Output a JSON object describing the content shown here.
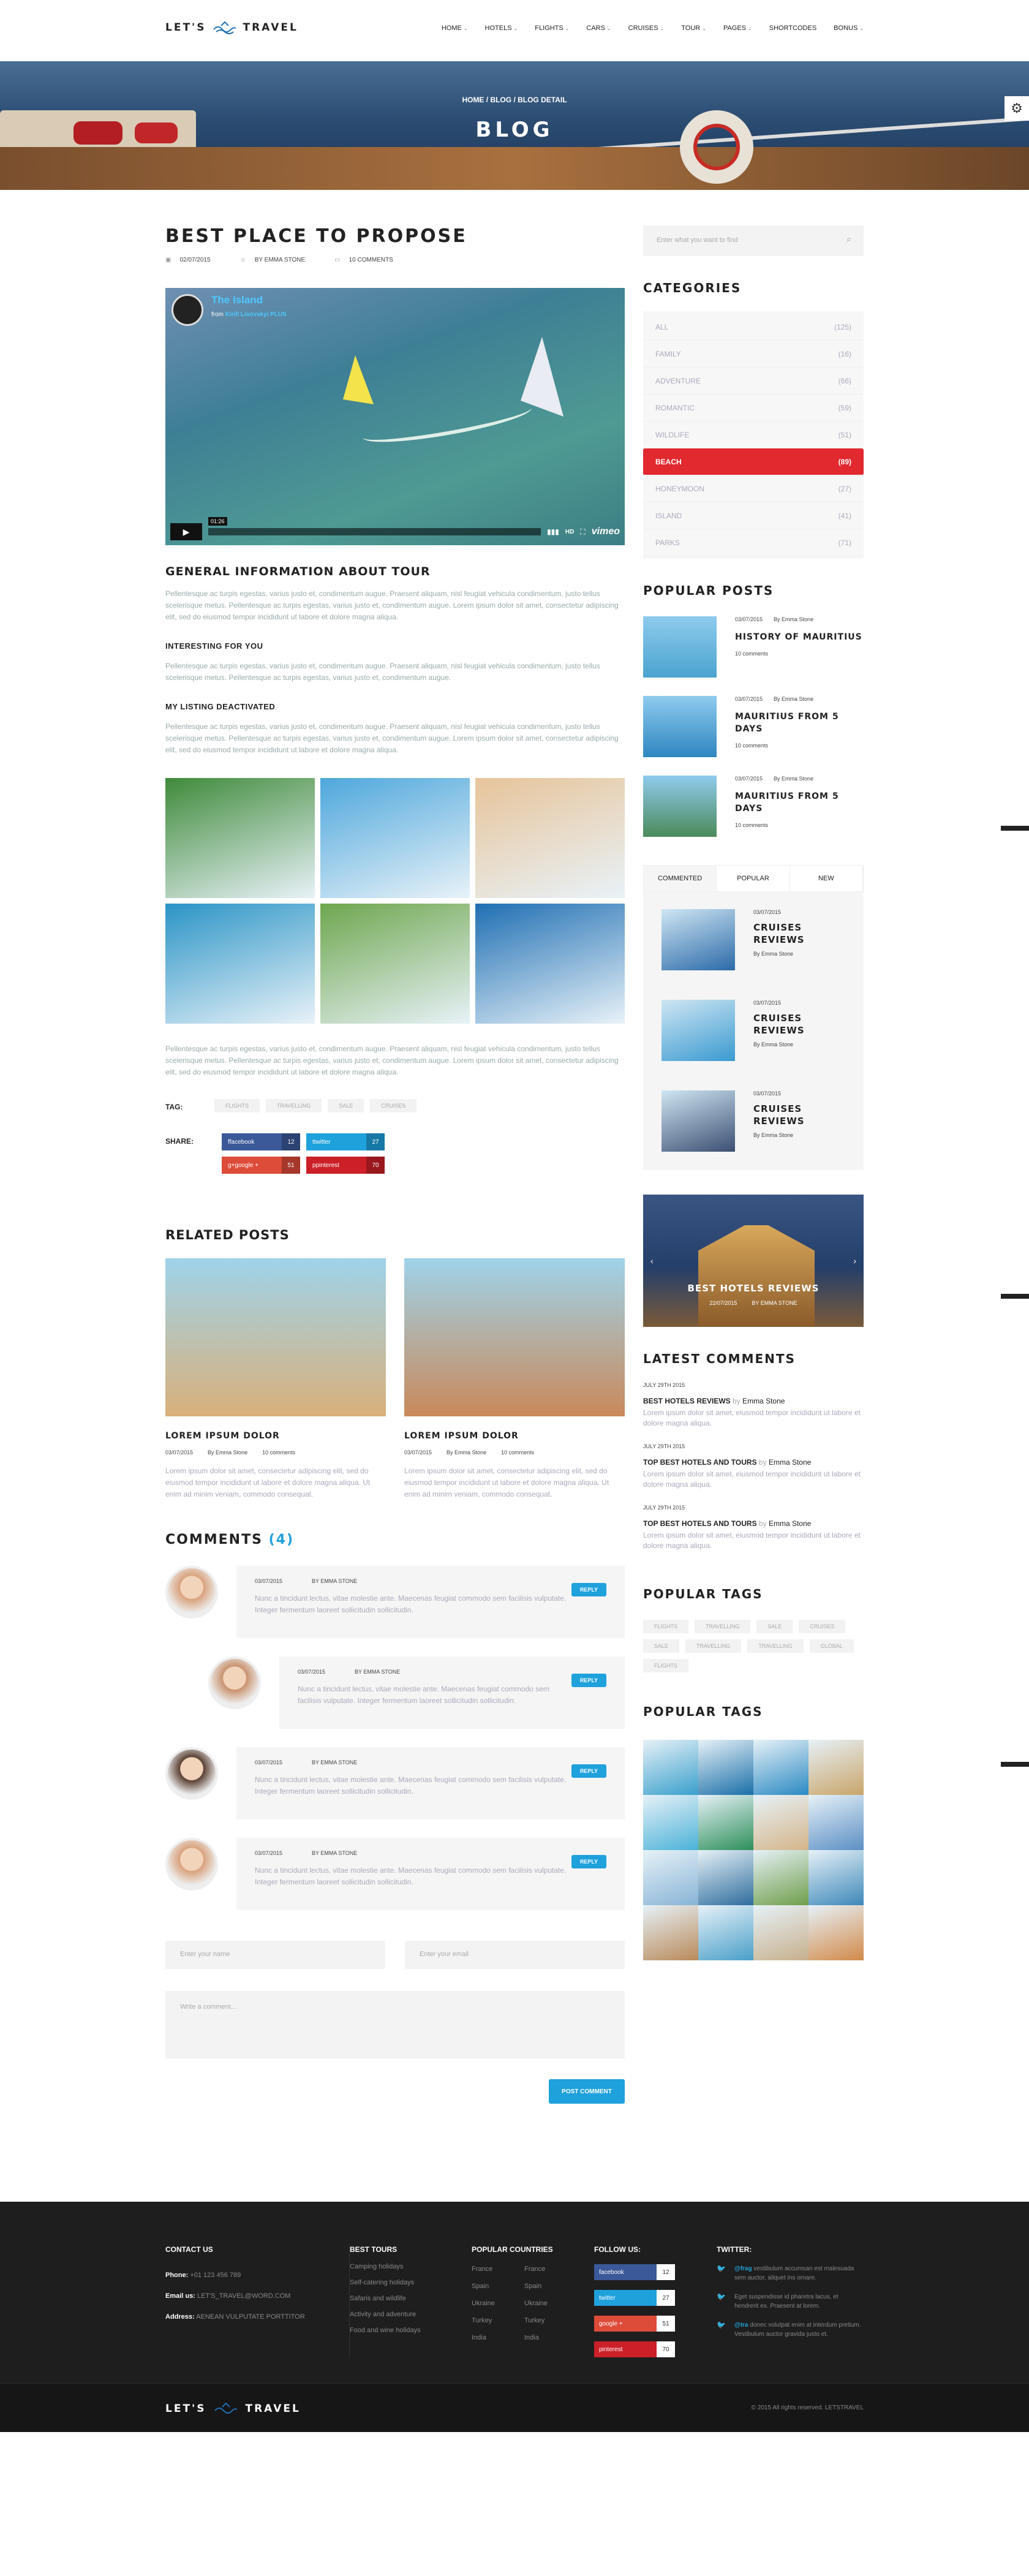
{
  "brand": {
    "name_left": "LET'S",
    "name_right": "TRAVEL"
  },
  "menu": [
    {
      "label": "HOME",
      "caret": "⌄"
    },
    {
      "label": "HOTELS",
      "caret": "⌄"
    },
    {
      "label": "FLIGHTS",
      "caret": "⌄"
    },
    {
      "label": "CARS",
      "caret": "⌄"
    },
    {
      "label": "CRUISES",
      "caret": "⌄"
    },
    {
      "label": "TOUR",
      "caret": "⌄"
    },
    {
      "label": "PAGES",
      "caret": "⌄"
    },
    {
      "label": "SHORTCODES",
      "caret": ""
    },
    {
      "label": "BONUS",
      "caret": "⌄"
    }
  ],
  "hero": {
    "breadcrumb": "HOME / BLOG / BLOG DETAIL",
    "title": "BLOG"
  },
  "post": {
    "title": "BEST PLACE TO PROPOSE",
    "date": "02/07/2015",
    "author": "BY EMMA STONE",
    "comments": "10 COMMENTS"
  },
  "video": {
    "title": "The Island",
    "from": "from",
    "owner": "Kirill Lisovskyi",
    "badge": "PLUS",
    "time": "01:26",
    "brand": "vimeo"
  },
  "section": {
    "heading": "GENERAL INFORMATION ABOUT TOUR",
    "para1": "Pellentesque ac turpis egestas, varius justo et, condimentum augue. Praesent aliquam, nisl feugiat vehicula condimentum, justo tellus scelerisque metus. Pellentesque ac turpis egestas, varius justo et, condimentum augue. Lorem ipsum dolor sit amet, consectetur adipiscing elit, sed do eiusmod tempor incididunt ut labore et dolore magna aliqua.",
    "sub1": "INTERESTING FOR YOU",
    "para2": "Pellentesque ac turpis egestas, varius justo et, condimentum augue. Praesent aliquam, nisl feugiat vehicula condimentum, justo tellus scelerisque metus. Pellentesque ac turpis egestas, varius justo et, condimentum augue.",
    "sub2": "MY LISTING DEACTIVATED",
    "para3": "Pellentesque ac turpis egestas, varius justo et, condimentum augue. Praesent aliquam, nisl feugiat vehicula condimentum, justo tellus scelerisque metus. Pellentesque ac turpis egestas, varius justo et, condimentum augue. Lorem ipsum dolor sit amet, consectetur adipiscing elit, sed do eiusmod tempor incididunt ut labore et dolore magna aliqua.",
    "para4": "Pellentesque ac turpis egestas, varius justo et, condimentum augue. Praesent aliquam, nisl feugiat vehicula condimentum, justo tellus scelerisque metus. Pellentesque ac turpis egestas, varius justo et, condimentum augue. Lorem ipsum dolor sit amet, consectetur adipiscing elit, sed do eiusmod tempor incididunt ut labore et dolore magna aliqua."
  },
  "gallery_colors": [
    "#3f8a3a",
    "#4ea7dc",
    "#e7c49a",
    "#2b94c6",
    "#6ea64e",
    "#1f6fb3"
  ],
  "tags": {
    "label": "TAG:",
    "items": [
      "FLIGHTS",
      "TRAVELLING",
      "SALE",
      "CRUISES"
    ]
  },
  "share": {
    "label": "SHARE:",
    "items": [
      {
        "name": "facebook",
        "count": "12",
        "color": "#3b5998"
      },
      {
        "name": "twitter",
        "count": "27",
        "color": "#1fa1dc"
      },
      {
        "name": "google +",
        "count": "51",
        "color": "#dd4b39"
      },
      {
        "name": "pinterest",
        "count": "70",
        "color": "#cb2027"
      }
    ]
  },
  "related": {
    "heading": "RELATED POSTS",
    "posts": [
      {
        "title": "LOREM IPSUM DOLOR",
        "date": "03/07/2015",
        "author": "By Emma Stone",
        "comments": "10 comments",
        "text": "Lorem ipsum dolor sit amet, consectetur adipiscing elit, sed do eiusmod tempor incididunt ut labore et dolore magna aliqua. Ut enim ad minim veniam, commodo consequat.",
        "color": "#d9b07a"
      },
      {
        "title": "LOREM IPSUM DOLOR",
        "date": "03/07/2015",
        "author": "By Emma Stone",
        "comments": "10 comments",
        "text": "Lorem ipsum dolor sit amet, consectetur adipiscing elit, sed do eiusmod tempor incididunt ut labore et dolore magna aliqua. Ut enim ad minim veniam, commodo consequat.",
        "color": "#c9895a"
      }
    ]
  },
  "comments": {
    "heading": "COMMENTS",
    "count": "(4)",
    "items": [
      {
        "date": "03/07/2015",
        "author": "BY EMMA STONE",
        "text": "Nunc a tincidunt lectus, vitae molestie ante. Maecenas feugiat commodo sem facilisis vulputate. Integer fermentum laoreet sollicitudin sollicitudin.",
        "reply": "REPLY"
      },
      {
        "date": "03/07/2015",
        "author": "BY EMMA STONE",
        "text": "Nunc a tincidunt lectus, vitae molestie ante. Maecenas feugiat commodo sem facilisis vulputate. Integer fermentum laoreet sollicitudin sollicitudin.",
        "reply": "REPLY"
      },
      {
        "date": "03/07/2015",
        "author": "BY EMMA STONE",
        "text": "Nunc a tincidunt lectus, vitae molestie ante. Maecenas feugiat commodo sem facilisis vulputate. Integer fermentum laoreet sollicitudin sollicitudin.",
        "reply": "REPLY"
      },
      {
        "date": "03/07/2015",
        "author": "BY EMMA STONE",
        "text": "Nunc a tincidunt lectus, vitae molestie ante. Maecenas feugiat commodo sem facilisis vulputate. Integer fermentum laoreet sollicitudin sollicitudin.",
        "reply": "REPLY"
      }
    ]
  },
  "form": {
    "name_ph": "Enter your name",
    "email_ph": "Enter your email",
    "comment_ph": "Write a comment...",
    "submit": "POST COMMENT"
  },
  "sidebar": {
    "search_ph": "Enter what you want to find",
    "categories_heading": "CATEGORIES",
    "categories": [
      {
        "name": "ALL",
        "count": "(125)"
      },
      {
        "name": "FAMILY",
        "count": "(16)"
      },
      {
        "name": "ADVENTURE",
        "count": "(66)"
      },
      {
        "name": "ROMANTIC",
        "count": "(59)"
      },
      {
        "name": "WILDLIFE",
        "count": "(51)"
      },
      {
        "name": "BEACH",
        "count": "(89)"
      },
      {
        "name": "HONEYMOON",
        "count": "(27)"
      },
      {
        "name": "ISLAND",
        "count": "(41)"
      },
      {
        "name": "PARKS",
        "count": "(71)"
      }
    ],
    "popular_heading": "POPULAR POSTS",
    "popular": [
      {
        "date": "03/07/2015",
        "author": "By Emma Stone",
        "title": "HISTORY OF MAURITIUS",
        "comments": "10 comments",
        "color": "#4aa3cf"
      },
      {
        "date": "03/07/2015",
        "author": "By Emma Stone",
        "title": "MAURITIUS FROM 5 DAYS",
        "comments": "10 comments",
        "color": "#2f86c1"
      },
      {
        "date": "03/07/2015",
        "author": "By Emma Stone",
        "title": "MAURITIUS FROM 5 DAYS",
        "comments": "10 comments",
        "color": "#4b8a5a"
      }
    ],
    "tabs": [
      "COMMENTED",
      "POPULAR",
      "NEW"
    ],
    "tab_items": [
      {
        "date": "03/07/2015",
        "title": "CRUISES REVIEWS",
        "author": "By Emma Stone",
        "color": "#2b6aa8"
      },
      {
        "date": "03/07/2015",
        "title": "CRUISES REVIEWS",
        "author": "By Emma Stone",
        "color": "#3a9ad0"
      },
      {
        "date": "03/07/2015",
        "title": "CRUISES REVIEWS",
        "author": "By Emma Stone",
        "color": "#3c4f72"
      }
    ],
    "hotel": {
      "title": "BEST HOTELS REVIEWS",
      "date": "22/07/2015",
      "author": "BY EMMA STONE",
      "prev": "‹",
      "next": "›"
    },
    "latest_heading": "LATEST COMMENTS",
    "latest": [
      {
        "date": "JULY 29TH 2015",
        "title": "BEST HOTELS REVIEWS",
        "by": "by",
        "author": "Emma Stone",
        "text": "Lorem ipsum dolor sit amet, eiusmod tempor incididunt ut labore et dolore magna aliqua."
      },
      {
        "date": "JULY 29TH 2015",
        "title": "TOP BEST HOTELS AND TOURS",
        "by": "by",
        "author": "Emma Stone",
        "text": "Lorem ipsum dolor sit amet, eiusmod tempor incididunt ut labore et dolore magna aliqua."
      },
      {
        "date": "JULY 29TH 2015",
        "title": "TOP BEST HOTELS AND TOURS",
        "by": "by",
        "author": "Emma Stone",
        "text": "Lorem ipsum dolor sit amet, eiusmod tempor incididunt ut labore et dolore magna aliqua."
      }
    ],
    "tags_heading": "POPULAR TAGS",
    "tags": [
      "FLIGHTS",
      "TRAVELLING",
      "SALE",
      "CRUISES",
      "SALE",
      "TRAVELLING",
      "TRAVELLING",
      "GLOBAL",
      "FLIGHTS"
    ],
    "photos_heading": "POPULAR TAGS",
    "photo_colors": [
      "#3aa0cc",
      "#1a6fa8",
      "#2a89c2",
      "#c9a56a",
      "#4bb2d8",
      "#2d8f5a",
      "#d4b58a",
      "#5c8fc4",
      "#88b4d6",
      "#2f6d9c",
      "#6f9e4a",
      "#3e88b8",
      "#b98a5a",
      "#4a9fc9",
      "#c7b08d",
      "#d28a4a"
    ]
  },
  "footer": {
    "contact_h": "CONTACT US",
    "phone_l": "Phone:",
    "phone": "+01 123 456 789",
    "email_l": "Email us:",
    "email": "LET'S_TRAVEL@WORD.COM",
    "addr_l": "Address:",
    "addr": "AENEAN VULPUTATE PORTTITOR",
    "tours_h": "BEST TOURS",
    "tours": [
      "Camping holidays",
      "Self-catering holidays",
      "Safaris and wildlife",
      "Activity and adventure",
      "Food and wine holidays"
    ],
    "countries_h": "POPULAR COUNTRIES",
    "countries": [
      "France",
      "France",
      "Spain",
      "Spain",
      "Ukraine",
      "Ukraine",
      "Turkey",
      "Turkey",
      "India",
      "India"
    ],
    "follow_h": "FOLLOW US:",
    "follow": [
      {
        "name": "facebook",
        "count": "12",
        "color": "#3b5998"
      },
      {
        "name": "twitter",
        "count": "27",
        "color": "#1fa1dc"
      },
      {
        "name": "google +",
        "count": "51",
        "color": "#dd4b39"
      },
      {
        "name": "pinterest",
        "count": "70",
        "color": "#cb2027"
      }
    ],
    "twitter_h": "TWITTER:",
    "tweets": [
      {
        "handle": "@frag",
        "text": "vestibulum accumsan est malesuada sem auctor, aliquet ins ornare."
      },
      {
        "handle": "",
        "text": "Eget suspendisse id pharetra lacus, et hendrerit ex. Praesent at lorem."
      },
      {
        "handle": "@tra",
        "text": "donec volutpat enim at interdum pretium. Vestibulum auctor gravida justo et."
      }
    ],
    "copyright": "© 2015 All rights reserved. LETSTRAVEL"
  }
}
